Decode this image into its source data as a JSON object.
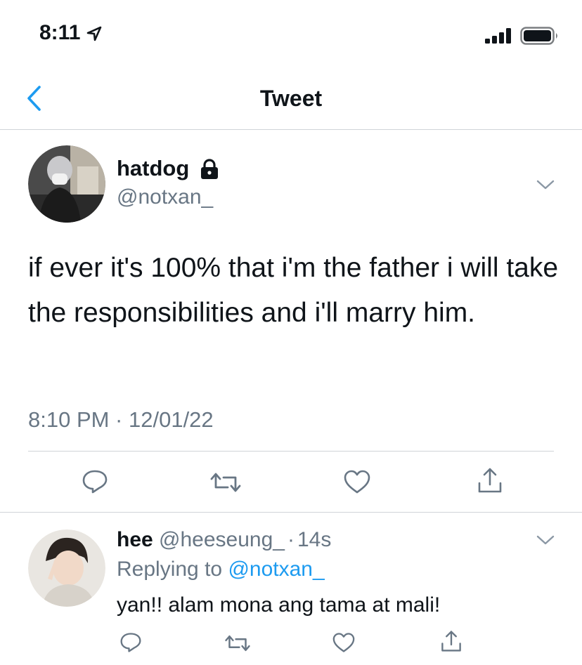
{
  "status_bar": {
    "time": "8:11",
    "icons": [
      "location-arrow-icon",
      "signal-bars-icon",
      "battery-icon"
    ]
  },
  "nav": {
    "title": "Tweet",
    "back_icon": "chevron-left-icon"
  },
  "tweet": {
    "display_name": "hatdog",
    "locked_icon": "lock-icon",
    "handle": "@notxan_",
    "text": "if ever it's 100% that i'm the father i will take the responsibilities and i'll marry him.",
    "timestamp": "8:10 PM · 12/01/22",
    "actions": [
      "reply-icon",
      "retweet-icon",
      "like-icon",
      "share-icon"
    ]
  },
  "reply": {
    "display_name": "hee",
    "handle": "@heeseung_",
    "separator": "·",
    "time": "14s",
    "replying_prefix": "Replying to",
    "replying_to": "@notxan_",
    "text": "yan!! alam mona ang tama at mali!",
    "actions": [
      "reply-icon",
      "retweet-icon",
      "like-icon",
      "share-icon"
    ]
  },
  "colors": {
    "accent": "#1d9bf0",
    "text": "#0f1419",
    "secondary": "#687684",
    "divider": "#d0d4d8"
  }
}
